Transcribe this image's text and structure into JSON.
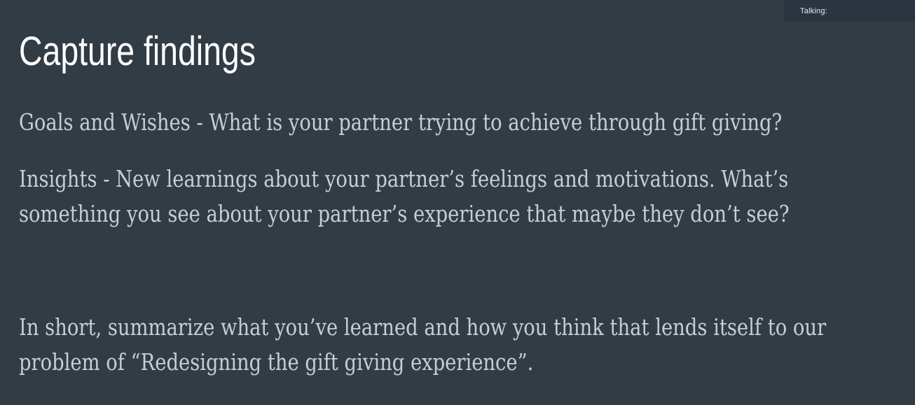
{
  "talking_indicator": {
    "label": "Talking:"
  },
  "slide": {
    "title": "Capture findings",
    "paragraphs": [
      {
        "lines": [
          "Goals and Wishes - What is your partner trying to achieve through gift giving?"
        ]
      },
      {
        "lines": [
          "Insights - New learnings about your partner’s feelings and motivations. What’s",
          "something you see about your partner’s experience that maybe they don’t see?"
        ]
      },
      {
        "lines": [
          "In short, summarize what you’ve learned and how you think that lends itself to our",
          "problem of “Redesigning the gift giving experience”."
        ]
      }
    ]
  },
  "colors": {
    "background": "#323c45",
    "title": "#ffffff",
    "body_text": "#c7cdd3",
    "talking_bar": "#2a3540"
  }
}
